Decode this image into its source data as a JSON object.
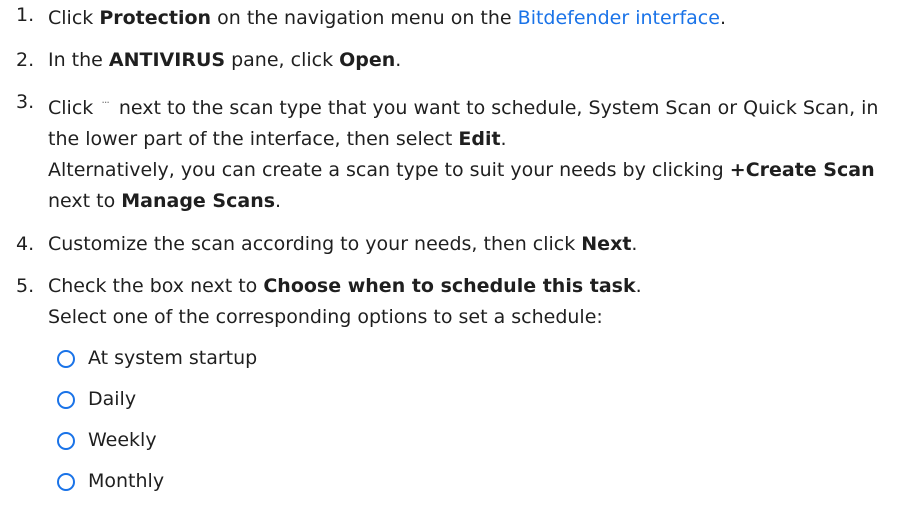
{
  "steps": [
    {
      "number": "1.",
      "t1": "Click ",
      "b1": "Protection",
      "t2": " on the navigation menu on the ",
      "link": "Bitdefender interface",
      "t3": "."
    },
    {
      "number": "2.",
      "t1": "In the ",
      "b1": "ANTIVIRUS",
      "t2": " pane, click ",
      "b2": "Open",
      "t3": "."
    },
    {
      "number": "3.",
      "t1": "Click",
      "icon": "more-options-icon",
      "t2": " next to the scan type that you want to schedule, System Scan or Quick Scan, in the lower part of the interface, then select ",
      "b1": "Edit",
      "t3": ".",
      "t4": "Alternatively, you can create a scan type to suit your needs by clicking ",
      "b2": "+Create Scan",
      "t5": " next to ",
      "b3": "Manage Scans",
      "t6": "."
    },
    {
      "number": "4.",
      "t1": "Customize the scan according to your needs, then click ",
      "b1": "Next",
      "t2": "."
    },
    {
      "number": "5.",
      "t1": "Check the box next to ",
      "b1": "Choose when to schedule this task",
      "t2": ".",
      "t3": "Select one of the corresponding options to set a schedule:",
      "options": [
        "At system startup",
        "Daily",
        "Weekly",
        "Monthly"
      ]
    }
  ],
  "colors": {
    "link": "#1a73e8",
    "radio": "#1a73e8",
    "text": "#1f1f1f"
  }
}
